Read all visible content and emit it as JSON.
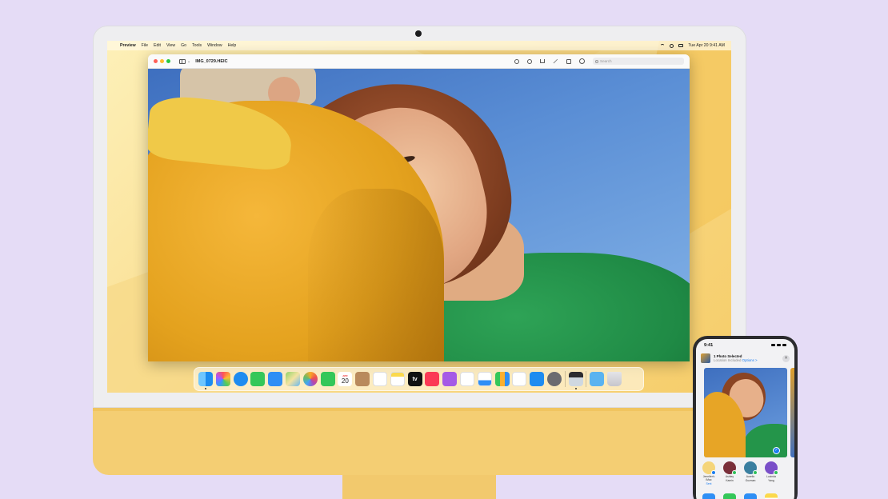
{
  "menubar": {
    "apple": "",
    "items": [
      "Preview",
      "File",
      "Edit",
      "View",
      "Go",
      "Tools",
      "Window",
      "Help"
    ],
    "datetime": "Tue Apr 20  9:41 AM"
  },
  "window": {
    "title": "IMG_0729.HEIC",
    "search_placeholder": "Search",
    "sidebar_chevron": "⌄"
  },
  "dock": {
    "calendar_month": "APR",
    "calendar_day": "20",
    "tv_label": "tv",
    "apps": [
      "Finder",
      "Launchpad",
      "Safari",
      "Messages",
      "Mail",
      "Maps",
      "Photos",
      "FaceTime",
      "Calendar",
      "Contacts",
      "Reminders",
      "Notes",
      "TV",
      "Music",
      "Podcasts",
      "News",
      "Keynote",
      "Numbers",
      "Pages",
      "App Store",
      "System Preferences",
      "Preview",
      "Downloads",
      "Trash"
    ]
  },
  "iphone": {
    "time": "9:41",
    "sheet_title": "1 Photo Selected",
    "sheet_subtitle": "Location Included",
    "sheet_options": "Options >",
    "close": "✕",
    "check": "✓",
    "people": [
      {
        "name": "Jennifer's iMac",
        "sub": "Sent",
        "color": "#f5d57a"
      },
      {
        "name": "Ashley",
        "sub": "Kamin",
        "color": "#7a2f3a"
      },
      {
        "name": "Aurelio",
        "sub": "Guzman",
        "color": "#3a7fa0"
      },
      {
        "name": "Lucinda",
        "sub": "Yang",
        "color": "#7a4fc8"
      }
    ]
  },
  "colors": {
    "accent": "#1a7cf0",
    "imac_yellow": "#f4ce73",
    "background": "#e5dcf6"
  }
}
